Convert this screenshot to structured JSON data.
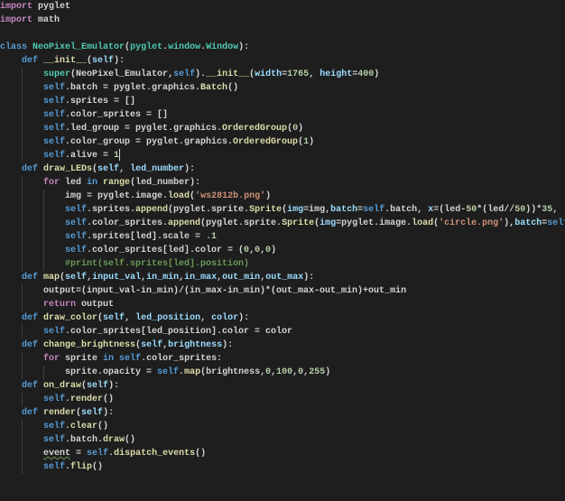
{
  "editor": {
    "language": "python",
    "colors": {
      "background": "#1e1e1e",
      "keyword": "#569cd6",
      "control": "#c586c0",
      "function": "#dcdcaa",
      "class": "#4ec9b0",
      "string": "#ce9178",
      "number": "#b5cea8",
      "variable": "#9cdcfe",
      "text": "#d4d4d4",
      "comment": "#6a9955"
    },
    "cursor_line": 12,
    "lines": [
      {
        "indent": 0,
        "tokens": [
          [
            "import",
            "c"
          ],
          [
            " pyglet",
            "d"
          ]
        ]
      },
      {
        "indent": 0,
        "tokens": [
          [
            "import",
            "c"
          ],
          [
            " math",
            "d"
          ]
        ]
      },
      {
        "indent": 0,
        "tokens": []
      },
      {
        "indent": 0,
        "tokens": [
          [
            "class ",
            "k"
          ],
          [
            "NeoPixel_Emulator",
            "t"
          ],
          [
            "(",
            "d"
          ],
          [
            "pyglet",
            "t"
          ],
          [
            ".",
            "d"
          ],
          [
            "window",
            "t"
          ],
          [
            ".",
            "d"
          ],
          [
            "Window",
            "t"
          ],
          [
            "):",
            "d"
          ]
        ]
      },
      {
        "indent": 1,
        "tokens": [
          [
            "def ",
            "k"
          ],
          [
            "__init__",
            "f"
          ],
          [
            "(",
            "d"
          ],
          [
            "self",
            "p"
          ],
          [
            "):",
            "d"
          ]
        ]
      },
      {
        "indent": 2,
        "tokens": [
          [
            "super",
            "t"
          ],
          [
            "(",
            "d"
          ],
          [
            "NeoPixel_Emulator",
            "d"
          ],
          [
            ",",
            "d"
          ],
          [
            "self",
            "k"
          ],
          [
            ").",
            "d"
          ],
          [
            "__init__",
            "f"
          ],
          [
            "(",
            "d"
          ],
          [
            "width",
            "p"
          ],
          [
            "=",
            "d"
          ],
          [
            "1765",
            "n"
          ],
          [
            ", ",
            "d"
          ],
          [
            "height",
            "p"
          ],
          [
            "=",
            "d"
          ],
          [
            "400",
            "n"
          ],
          [
            ")",
            "d"
          ]
        ]
      },
      {
        "indent": 2,
        "tokens": [
          [
            "self",
            "k"
          ],
          [
            ".batch = pyglet.graphics.",
            "d"
          ],
          [
            "Batch",
            "f"
          ],
          [
            "()",
            "d"
          ]
        ]
      },
      {
        "indent": 2,
        "tokens": [
          [
            "self",
            "k"
          ],
          [
            ".sprites = []",
            "d"
          ]
        ]
      },
      {
        "indent": 2,
        "tokens": [
          [
            "self",
            "k"
          ],
          [
            ".color_sprites = []",
            "d"
          ]
        ]
      },
      {
        "indent": 2,
        "tokens": [
          [
            "self",
            "k"
          ],
          [
            ".led_group = pyglet.graphics.",
            "d"
          ],
          [
            "OrderedGroup",
            "f"
          ],
          [
            "(",
            "d"
          ],
          [
            "0",
            "n"
          ],
          [
            ")",
            "d"
          ]
        ]
      },
      {
        "indent": 2,
        "tokens": [
          [
            "self",
            "k"
          ],
          [
            ".color_group = pyglet.graphics.",
            "d"
          ],
          [
            "OrderedGroup",
            "f"
          ],
          [
            "(",
            "d"
          ],
          [
            "1",
            "n"
          ],
          [
            ")",
            "d"
          ]
        ]
      },
      {
        "indent": 2,
        "tokens": [
          [
            "self",
            "k"
          ],
          [
            ".alive = ",
            "d"
          ],
          [
            "1",
            "n"
          ]
        ]
      },
      {
        "indent": 1,
        "tokens": [
          [
            "def ",
            "k"
          ],
          [
            "draw_LEDs",
            "f"
          ],
          [
            "(",
            "d"
          ],
          [
            "self",
            "p"
          ],
          [
            ", ",
            "d"
          ],
          [
            "led_number",
            "p"
          ],
          [
            "):",
            "d"
          ]
        ]
      },
      {
        "indent": 2,
        "tokens": [
          [
            "for",
            "c"
          ],
          [
            " led ",
            "d"
          ],
          [
            "in ",
            "k"
          ],
          [
            "range",
            "f"
          ],
          [
            "(led_number):",
            "d"
          ]
        ]
      },
      {
        "indent": 3,
        "tokens": [
          [
            "img = pyglet.image.",
            "d"
          ],
          [
            "load",
            "f"
          ],
          [
            "(",
            "d"
          ],
          [
            "'ws2812b.png'",
            "s"
          ],
          [
            ")",
            "d"
          ]
        ]
      },
      {
        "indent": 3,
        "tokens": [
          [
            "self",
            "k"
          ],
          [
            ".sprites.",
            "d"
          ],
          [
            "append",
            "f"
          ],
          [
            "(pyglet.sprite.",
            "d"
          ],
          [
            "Sprite",
            "f"
          ],
          [
            "(",
            "d"
          ],
          [
            "img",
            "p"
          ],
          [
            "=img,",
            "d"
          ],
          [
            "batch",
            "p"
          ],
          [
            "=",
            "d"
          ],
          [
            "self",
            "k"
          ],
          [
            ".batch, ",
            "d"
          ],
          [
            "x",
            "p"
          ],
          [
            "=(led-",
            "d"
          ],
          [
            "50",
            "n"
          ],
          [
            "*(led//",
            "d"
          ],
          [
            "50",
            "n"
          ],
          [
            "))*",
            "d"
          ],
          [
            "35",
            "n"
          ],
          [
            ",",
            "d"
          ]
        ]
      },
      {
        "indent": 3,
        "tokens": [
          [
            "self",
            "k"
          ],
          [
            ".color_sprites.",
            "d"
          ],
          [
            "append",
            "f"
          ],
          [
            "(pyglet.sprite.",
            "d"
          ],
          [
            "Sprite",
            "f"
          ],
          [
            "(",
            "d"
          ],
          [
            "img",
            "p"
          ],
          [
            "=pyglet.image.",
            "d"
          ],
          [
            "load",
            "f"
          ],
          [
            "(",
            "d"
          ],
          [
            "'circle.png'",
            "s"
          ],
          [
            "),",
            "d"
          ],
          [
            "batch",
            "p"
          ],
          [
            "=",
            "d"
          ],
          [
            "self",
            "k"
          ]
        ]
      },
      {
        "indent": 3,
        "tokens": [
          [
            "self",
            "k"
          ],
          [
            ".sprites[led].scale = ",
            "d"
          ],
          [
            ".1",
            "n"
          ]
        ]
      },
      {
        "indent": 3,
        "tokens": [
          [
            "self",
            "k"
          ],
          [
            ".color_sprites[led].color = (",
            "d"
          ],
          [
            "0",
            "n"
          ],
          [
            ",",
            "d"
          ],
          [
            "0",
            "n"
          ],
          [
            ",",
            "d"
          ],
          [
            "0",
            "n"
          ],
          [
            ")",
            "d"
          ]
        ]
      },
      {
        "indent": 3,
        "tokens": [
          [
            "#print(self.sprites[led].position)",
            "m"
          ]
        ]
      },
      {
        "indent": 1,
        "tokens": [
          [
            "def ",
            "k"
          ],
          [
            "map",
            "f"
          ],
          [
            "(",
            "d"
          ],
          [
            "self",
            "p"
          ],
          [
            ",",
            "d"
          ],
          [
            "input_val",
            "p"
          ],
          [
            ",",
            "d"
          ],
          [
            "in_min",
            "p"
          ],
          [
            ",",
            "d"
          ],
          [
            "in_max",
            "p"
          ],
          [
            ",",
            "d"
          ],
          [
            "out_min",
            "p"
          ],
          [
            ",",
            "d"
          ],
          [
            "out_max",
            "p"
          ],
          [
            "):",
            "d"
          ]
        ]
      },
      {
        "indent": 2,
        "tokens": [
          [
            "output=(input_val-in_min)/(in_max-in_min)*(out_max-out_min)+out_min",
            "d"
          ]
        ]
      },
      {
        "indent": 2,
        "tokens": [
          [
            "return",
            "c"
          ],
          [
            " output",
            "d"
          ]
        ]
      },
      {
        "indent": 1,
        "tokens": [
          [
            "def ",
            "k"
          ],
          [
            "draw_color",
            "f"
          ],
          [
            "(",
            "d"
          ],
          [
            "self",
            "p"
          ],
          [
            ", ",
            "d"
          ],
          [
            "led_position",
            "p"
          ],
          [
            ", ",
            "d"
          ],
          [
            "color",
            "p"
          ],
          [
            "):",
            "d"
          ]
        ]
      },
      {
        "indent": 2,
        "tokens": [
          [
            "self",
            "k"
          ],
          [
            ".color_sprites[led_position].color = color",
            "d"
          ]
        ]
      },
      {
        "indent": 1,
        "tokens": [
          [
            "def ",
            "k"
          ],
          [
            "change_brightness",
            "f"
          ],
          [
            "(",
            "d"
          ],
          [
            "self",
            "p"
          ],
          [
            ",",
            "d"
          ],
          [
            "brightness",
            "p"
          ],
          [
            "):",
            "d"
          ]
        ]
      },
      {
        "indent": 2,
        "tokens": [
          [
            "for",
            "c"
          ],
          [
            " sprite ",
            "d"
          ],
          [
            "in ",
            "k"
          ],
          [
            "self",
            "k"
          ],
          [
            ".color_sprites:",
            "d"
          ]
        ]
      },
      {
        "indent": 3,
        "tokens": [
          [
            "sprite.opacity = ",
            "d"
          ],
          [
            "self",
            "k"
          ],
          [
            ".",
            "d"
          ],
          [
            "map",
            "f"
          ],
          [
            "(brightness,",
            "d"
          ],
          [
            "0",
            "n"
          ],
          [
            ",",
            "d"
          ],
          [
            "100",
            "n"
          ],
          [
            ",",
            "d"
          ],
          [
            "0",
            "n"
          ],
          [
            ",",
            "d"
          ],
          [
            "255",
            "n"
          ],
          [
            ")",
            "d"
          ]
        ]
      },
      {
        "indent": 1,
        "tokens": [
          [
            "def ",
            "k"
          ],
          [
            "on_draw",
            "f"
          ],
          [
            "(",
            "d"
          ],
          [
            "self",
            "p"
          ],
          [
            "):",
            "d"
          ]
        ]
      },
      {
        "indent": 2,
        "tokens": [
          [
            "self",
            "k"
          ],
          [
            ".",
            "d"
          ],
          [
            "render",
            "f"
          ],
          [
            "()",
            "d"
          ]
        ]
      },
      {
        "indent": 1,
        "tokens": [
          [
            "def ",
            "k"
          ],
          [
            "render",
            "f"
          ],
          [
            "(",
            "d"
          ],
          [
            "self",
            "p"
          ],
          [
            "):",
            "d"
          ]
        ]
      },
      {
        "indent": 2,
        "tokens": [
          [
            "self",
            "k"
          ],
          [
            ".",
            "d"
          ],
          [
            "clear",
            "f"
          ],
          [
            "()",
            "d"
          ]
        ]
      },
      {
        "indent": 2,
        "tokens": [
          [
            "self",
            "k"
          ],
          [
            ".batch.",
            "d"
          ],
          [
            "draw",
            "f"
          ],
          [
            "()",
            "d"
          ]
        ]
      },
      {
        "indent": 2,
        "tokens": [
          [
            "event",
            "w"
          ],
          [
            " = ",
            "d"
          ],
          [
            "self",
            "k"
          ],
          [
            ".",
            "d"
          ],
          [
            "dispatch_events",
            "f"
          ],
          [
            "()",
            "d"
          ]
        ]
      },
      {
        "indent": 2,
        "tokens": [
          [
            "self",
            "k"
          ],
          [
            ".",
            "d"
          ],
          [
            "flip",
            "f"
          ],
          [
            "()",
            "d"
          ]
        ]
      }
    ]
  }
}
